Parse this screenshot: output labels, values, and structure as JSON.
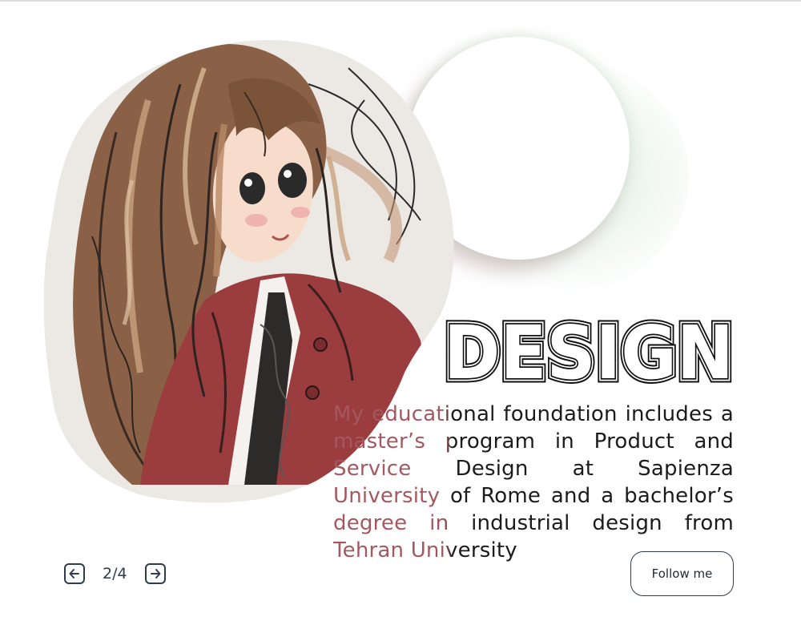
{
  "hero": {
    "illustration": "anime-girl-red-jacket-illustration",
    "title": "DESIGN",
    "description": "My educational foundation includes a master’s program in Product and Service Design at Sapienza University of Rome and a bachelor’s degree in industrial design from Tehran University"
  },
  "pager": {
    "prev_icon": "arrow-left-icon",
    "next_icon": "arrow-right-icon",
    "current": 2,
    "total": 4,
    "label": "2/4"
  },
  "actions": {
    "follow_label": "Follow me"
  },
  "colors": {
    "text": "#1b1b1b",
    "accent_text": "#a4575f",
    "outline": "#2e3d4d",
    "jacket": "#9b3d3e",
    "hair": "#7a5238"
  }
}
